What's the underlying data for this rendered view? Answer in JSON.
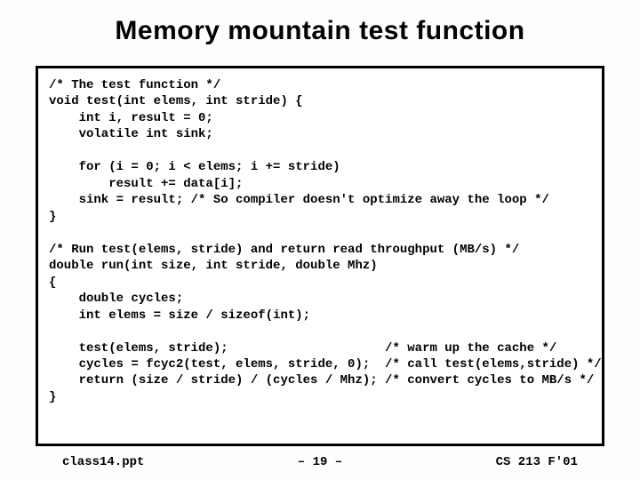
{
  "title": "Memory mountain test function",
  "code": "/* The test function */\nvoid test(int elems, int stride) {\n    int i, result = 0;\n    volatile int sink;\n\n    for (i = 0; i < elems; i += stride)\n        result += data[i];\n    sink = result; /* So compiler doesn't optimize away the loop */\n}\n\n/* Run test(elems, stride) and return read throughput (MB/s) */\ndouble run(int size, int stride, double Mhz)\n{\n    double cycles;\n    int elems = size / sizeof(int);\n\n    test(elems, stride);                     /* warm up the cache */\n    cycles = fcyc2(test, elems, stride, 0);  /* call test(elems,stride) */\n    return (size / stride) / (cycles / Mhz); /* convert cycles to MB/s */\n}",
  "footer": {
    "left": "class14.ppt",
    "center": "– 19 –",
    "right": "CS 213 F'01"
  }
}
